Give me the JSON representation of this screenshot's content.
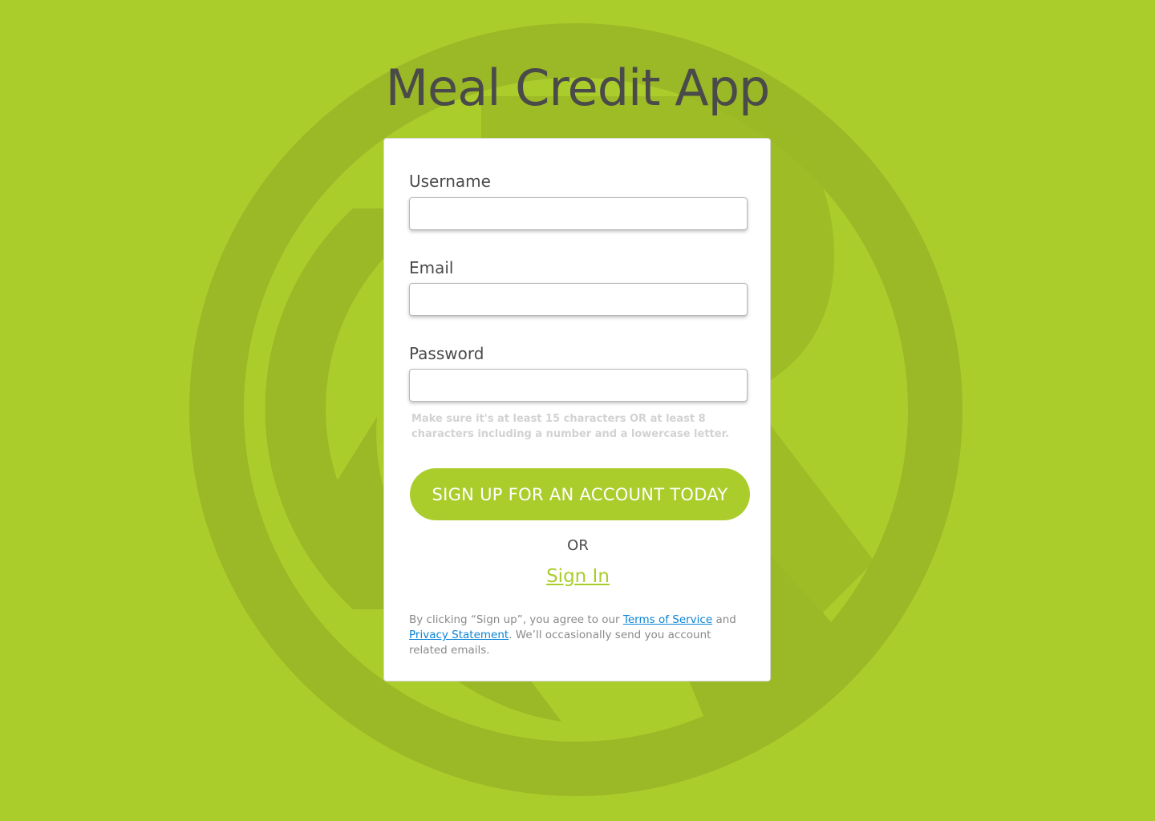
{
  "page": {
    "title": "Meal Credit App",
    "background_color": "#abcd2c",
    "accent_color": "#abcd2c"
  },
  "form": {
    "username": {
      "label": "Username",
      "value": "",
      "placeholder": ""
    },
    "email": {
      "label": "Email",
      "value": "",
      "placeholder": ""
    },
    "password": {
      "label": "Password",
      "value": "",
      "placeholder": "",
      "hint": "Make sure it's at least 15 characters OR at least 8 characters including a number and a lowercase letter."
    },
    "signup_button_label": "SIGN UP FOR AN ACCOUNT TODAY",
    "or_text": "OR",
    "signin_link_label": "Sign In"
  },
  "legal": {
    "prefix": "By clicking “Sign up”, you agree to our ",
    "terms_link": "Terms of Service",
    "and_text": " and ",
    "privacy_link": "Privacy Statement",
    "suffix": ". We’ll occasionally send you account related emails."
  }
}
